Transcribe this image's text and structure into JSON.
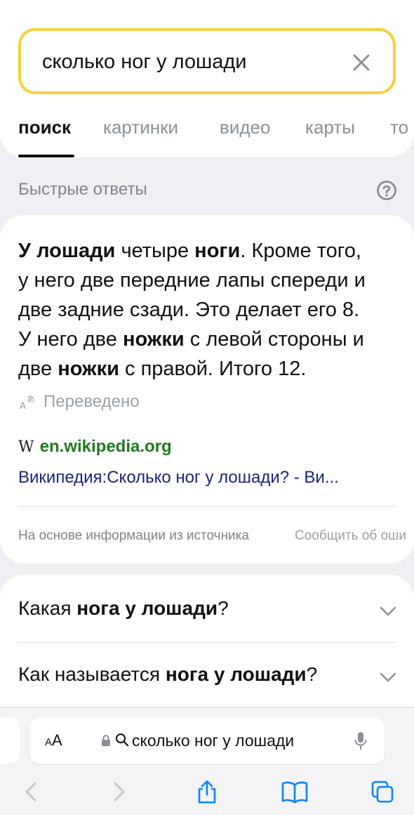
{
  "search": {
    "query": "сколько ног у лошади"
  },
  "tabs": [
    "поиск",
    "картинки",
    "видео",
    "карты",
    "то"
  ],
  "quick_answers": {
    "title": "Быстрые ответы",
    "answer": {
      "line1": {
        "b1": "У лошади",
        "t1": " четыре ",
        "b2": "ноги",
        "t2": ". Кроме того,"
      },
      "line2": "у него две передние лапы спереди и",
      "line3": "две задние сзади. Это делает его 8.",
      "line4": {
        "t1": "У него две ",
        "b1": "ножки",
        "t2": " с левой стороны и"
      },
      "line5": {
        "t1": "две ",
        "b1": "ножки",
        "t2": " с правой. Итого 12."
      }
    },
    "translated_label": "Переведено",
    "source_domain": "en.wikipedia.org",
    "source_title": "Википедия:Сколько ног у лошади? - Ви...",
    "footer_note": "На основе информации из источника",
    "report_label": "Сообщить об оши"
  },
  "related_questions": [
    {
      "t1": "Какая ",
      "b1": "нога у лошади",
      "t2": "?"
    },
    {
      "t1": "Как называется ",
      "b1": "нога у лошади",
      "t2": "?"
    }
  ],
  "browser": {
    "text_size_label_small": "A",
    "text_size_label_large": "A",
    "address": "сколько ног у лошади"
  },
  "colors": {
    "search_border": "#f6cf3c",
    "source_green": "#1f7a1f",
    "link_blue": "#1a237e",
    "ios_blue": "#0a84ff"
  }
}
